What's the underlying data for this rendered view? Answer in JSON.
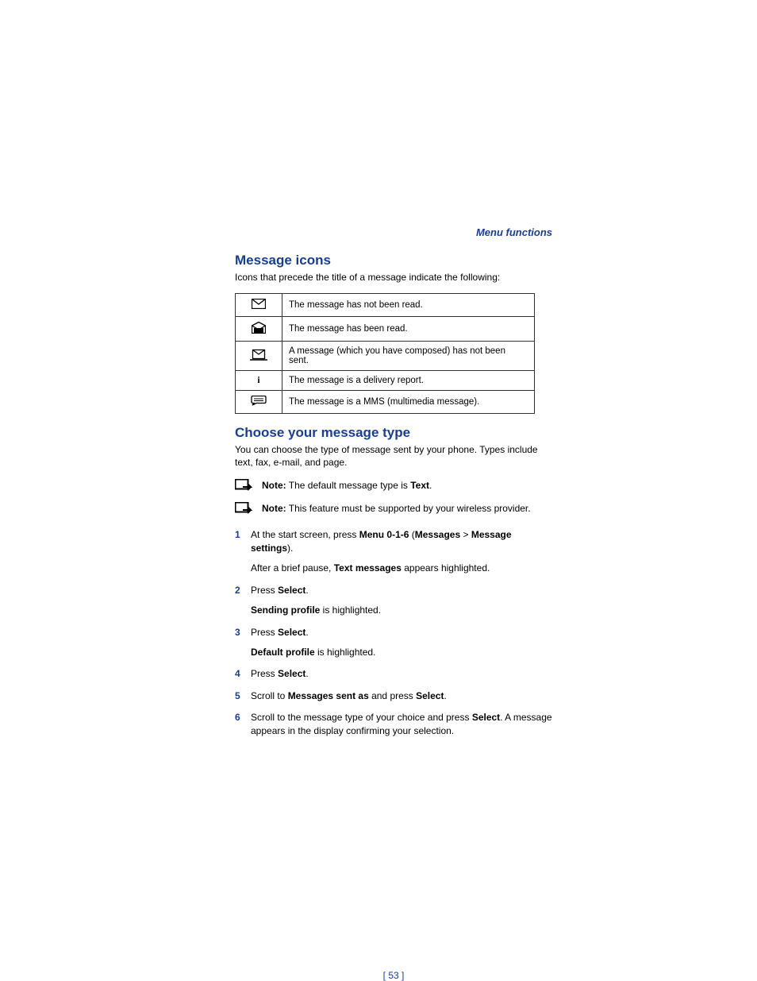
{
  "breadcrumb": "Menu functions",
  "section1": {
    "title": "Message icons",
    "intro": "Icons that precede the title of a message indicate the following:",
    "rows": [
      {
        "icon": "envelope-closed-icon",
        "desc": "The message has not been read."
      },
      {
        "icon": "envelope-open-icon",
        "desc": "The message has been read."
      },
      {
        "icon": "envelope-draft-icon",
        "desc": "A message (which you have composed) has not been sent."
      },
      {
        "icon": "info-i-icon",
        "desc": "The message is a delivery report."
      },
      {
        "icon": "mms-bubble-icon",
        "desc": "The message is a MMS (multimedia message)."
      }
    ]
  },
  "section2": {
    "title": "Choose your message type",
    "intro": "You can choose the type of message sent by your phone. Types include text, fax, e-mail, and page.",
    "note1": {
      "label": "Note:",
      "text_pre": " The default message type is ",
      "bold": "Text",
      "text_post": "."
    },
    "note2": {
      "label": "Note:",
      "text": " This feature must be supported by your wireless provider."
    },
    "steps": {
      "s1": {
        "pre": "At the start screen, press ",
        "b1": "Menu 0-1-6",
        "mid1": " (",
        "b2": "Messages",
        "gt": " > ",
        "b3": "Message settings",
        "post": ").",
        "sub_pre": "After a brief pause, ",
        "sub_b": "Text messages",
        "sub_post": " appears highlighted."
      },
      "s2": {
        "pre": "Press ",
        "b1": "Select",
        "post": ".",
        "sub_b": "Sending profile",
        "sub_post": " is highlighted."
      },
      "s3": {
        "pre": "Press ",
        "b1": "Select",
        "post": ".",
        "sub_b": "Default profile",
        "sub_post": " is highlighted."
      },
      "s4": {
        "pre": "Press ",
        "b1": "Select",
        "post": "."
      },
      "s5": {
        "pre": "Scroll to ",
        "b1": "Messages sent as",
        "mid": " and press ",
        "b2": "Select",
        "post": "."
      },
      "s6": {
        "pre": "Scroll to the message type of your choice and press ",
        "b1": "Select",
        "post": ". A message appears in the display confirming your selection."
      }
    }
  },
  "page_number": "[ 53 ]"
}
